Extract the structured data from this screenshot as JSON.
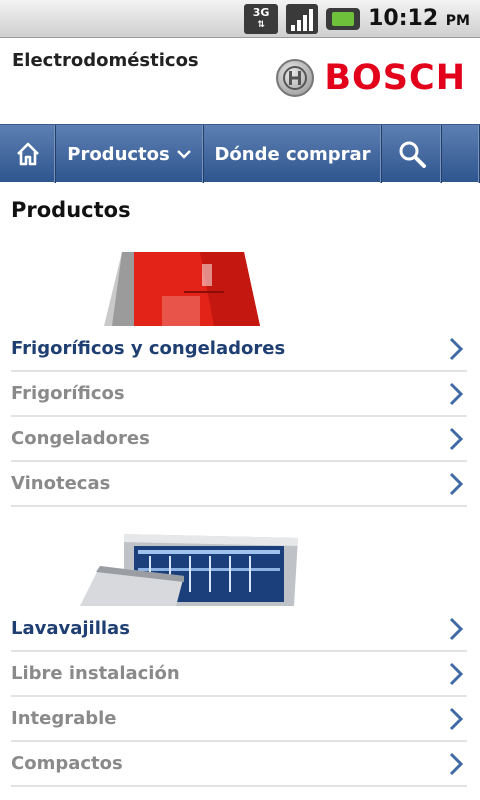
{
  "status_bar": {
    "network": "3G",
    "time": "10:12",
    "ampm": "PM"
  },
  "header": {
    "title": "Electrodomésticos",
    "logo_text": "BOSCH"
  },
  "nav": {
    "products_label": "Productos",
    "where_to_buy_label": "Dónde comprar"
  },
  "main": {
    "title": "Productos",
    "sections": [
      {
        "category": "Frigoríficos y congeladores",
        "items": [
          "Frigoríficos",
          "Congeladores",
          "Vinotecas"
        ]
      },
      {
        "category": "Lavavajillas",
        "items": [
          "Libre instalación",
          "Integrable",
          "Compactos"
        ]
      }
    ]
  },
  "colors": {
    "brand_red": "#e2001a",
    "nav_blue": "#3a5f96",
    "category_text": "#1f3f72",
    "item_text": "#8a8a8a"
  },
  "icons": [
    "home-icon",
    "chevron-down-icon",
    "search-icon",
    "chevron-right-icon",
    "bosch-armature-icon",
    "network-3g-icon",
    "signal-icon",
    "battery-icon"
  ]
}
